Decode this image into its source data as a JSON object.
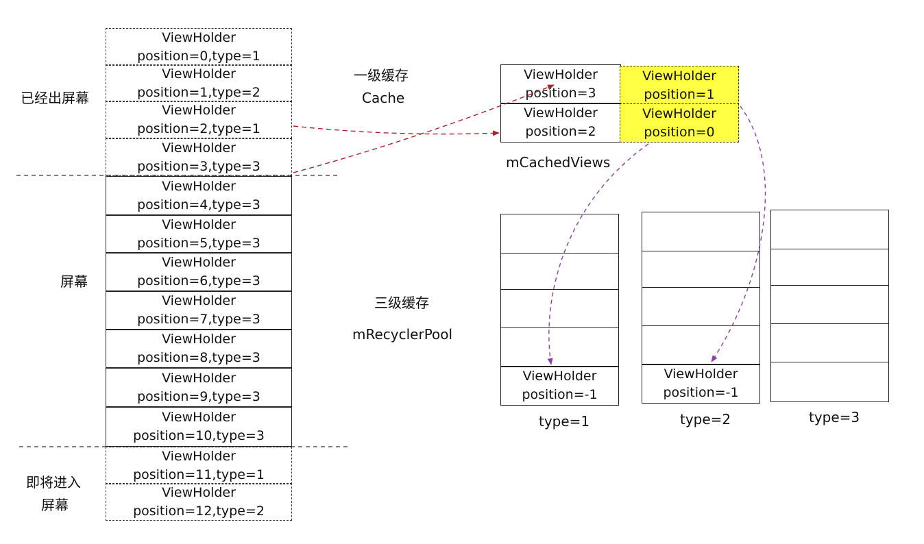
{
  "list": {
    "items": [
      {
        "title": "ViewHolder",
        "sub": "position=0,type=1"
      },
      {
        "title": "ViewHolder",
        "sub": "position=1,type=2"
      },
      {
        "title": "ViewHolder",
        "sub": "position=2,type=1"
      },
      {
        "title": "ViewHolder",
        "sub": "position=3,type=3"
      },
      {
        "title": "ViewHolder",
        "sub": "position=4,type=3"
      },
      {
        "title": "ViewHolder",
        "sub": "position=5,type=3"
      },
      {
        "title": "ViewHolder",
        "sub": "position=6,type=3"
      },
      {
        "title": "ViewHolder",
        "sub": "position=7,type=3"
      },
      {
        "title": "ViewHolder",
        "sub": "position=8,type=3"
      },
      {
        "title": "ViewHolder",
        "sub": "position=9,type=3"
      },
      {
        "title": "ViewHolder",
        "sub": "position=10,type=3"
      },
      {
        "title": "ViewHolder",
        "sub": "position=11,type=1"
      },
      {
        "title": "ViewHolder",
        "sub": "position=12,type=2"
      }
    ]
  },
  "side_labels": {
    "offscreen": "已经出屏幕",
    "screen": "屏幕",
    "incoming_line1": "即将进入",
    "incoming_line2": "屏幕"
  },
  "cache": {
    "level_label": "一级缓存",
    "name": "Cache",
    "views_label": "mCachedViews",
    "cells": [
      {
        "title": "ViewHolder",
        "sub": "position=3"
      },
      {
        "title": "ViewHolder",
        "sub": "position=1"
      },
      {
        "title": "ViewHolder",
        "sub": "position=2"
      },
      {
        "title": "ViewHolder",
        "sub": "position=0"
      }
    ]
  },
  "pool": {
    "level_label": "三级缓存",
    "name": "mRecyclerPool",
    "columns": [
      {
        "type_label": "type=1",
        "holder": {
          "title": "ViewHolder",
          "sub": "position=-1"
        }
      },
      {
        "type_label": "type=2",
        "holder": {
          "title": "ViewHolder",
          "sub": "position=-1"
        }
      },
      {
        "type_label": "type=3"
      }
    ]
  },
  "colors": {
    "cache_arrow": "#a8232a",
    "pool_arrow": "#8e3fa6",
    "highlight": "#ffff44"
  }
}
